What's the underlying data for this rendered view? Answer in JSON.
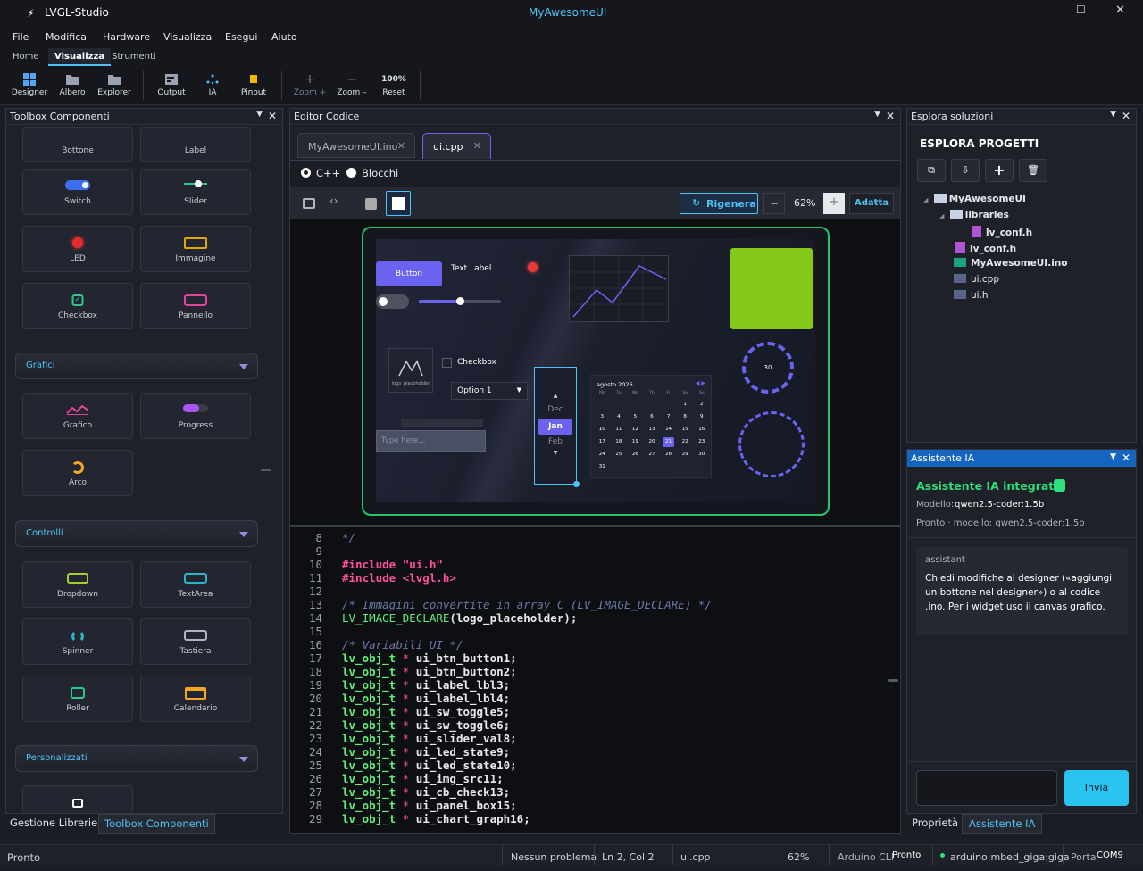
{
  "app": {
    "name": "LVGL-Studio",
    "window_title": "MyAwesomeUI"
  },
  "menu": [
    "File",
    "Modifica",
    "Hardware",
    "Visualizza",
    "Esegui",
    "Aiuto"
  ],
  "tabs": [
    "Home",
    "Visualizza",
    "Strumenti"
  ],
  "ribbon": {
    "designer": "Designer",
    "albero": "Albero",
    "explorer": "Explorer",
    "output": "Output",
    "ia": "IA",
    "pinout": "Pinout",
    "zoom_in": "Zoom +",
    "zoom_out": "Zoom –",
    "reset_value": "100%",
    "reset": "Reset"
  },
  "toolbox": {
    "title": "Toolbox Componenti",
    "items_top": [
      "Bottone",
      "Label",
      "Switch",
      "Slider",
      "LED",
      "Immagine",
      "Checkbox",
      "Pannello"
    ],
    "cat_graphs": "Grafici",
    "items_graphs": [
      "Grafico",
      "Progress",
      "Arco"
    ],
    "cat_controls": "Controlli",
    "items_controls": [
      "Dropdown",
      "TextArea",
      "Spinner",
      "Tastiera",
      "Roller",
      "Calendario"
    ],
    "cat_custom": "Personalizzati",
    "bottom_tabs": [
      "Gestione Librerie",
      "Toolbox Componenti"
    ]
  },
  "editor": {
    "title": "Editor Codice",
    "tabs": [
      "MyAwesomeUI.ino",
      "ui.cpp"
    ],
    "mode_cpp": "C++",
    "mode_blocks": "Blocchi",
    "regen": "Rigenera",
    "zoom": "62%",
    "fit": "Adatta",
    "preview": {
      "button": "Button",
      "text_label": "Text Label",
      "checkbox": "Checkbox",
      "dropdown": "Option 1",
      "placeholder": "Type here...",
      "logo": "logo_placeholder",
      "roller": [
        "Dec",
        "Jan",
        "Feb"
      ],
      "arc_value": "30",
      "calendar_title": "agosto 2026",
      "calendar_days": [
        "Mo",
        "Tu",
        "We",
        "Th",
        "Fr",
        "Sa",
        "Su"
      ],
      "calendar_rows": [
        [
          "",
          "",
          "",
          "",
          "",
          "1",
          "2"
        ],
        [
          "3",
          "4",
          "5",
          "6",
          "7",
          "8",
          "9"
        ],
        [
          "10",
          "11",
          "12",
          "13",
          "14",
          "15",
          "16"
        ],
        [
          "17",
          "18",
          "19",
          "20",
          "21",
          "22",
          "23"
        ],
        [
          "24",
          "25",
          "26",
          "27",
          "28",
          "29",
          "30"
        ],
        [
          "31",
          "",
          "",
          "",
          "",
          "",
          ""
        ]
      ],
      "calendar_selected": "21"
    },
    "line_numbers": [
      "8",
      "9",
      "10",
      "11",
      "12",
      "13",
      "14",
      "15",
      "16",
      "17",
      "18",
      "19",
      "20",
      "21",
      "22",
      "23",
      "24",
      "25",
      "26",
      "27",
      "28",
      "29"
    ],
    "code_lines": [
      {
        "t": "*/",
        "c": "comment"
      },
      {
        "t": "",
        "c": "plain"
      },
      {
        "t": "#include \"ui.h\"",
        "c": "pre"
      },
      {
        "t": "#include <lvgl.h>",
        "c": "pre"
      },
      {
        "t": "",
        "c": "plain"
      },
      {
        "t": "/* Immagini convertite in array C (LV_IMAGE_DECLARE) */",
        "c": "comment"
      },
      {
        "t": "LV_IMAGE_DECLARE(logo_placeholder);",
        "c": "macro"
      },
      {
        "t": "",
        "c": "plain"
      },
      {
        "t": "/* Variabili UI */",
        "c": "comment"
      },
      {
        "t": "lv_obj_t * ui_btn_button1;",
        "c": "decl"
      },
      {
        "t": "lv_obj_t * ui_btn_button2;",
        "c": "decl"
      },
      {
        "t": "lv_obj_t * ui_label_lbl3;",
        "c": "decl"
      },
      {
        "t": "lv_obj_t * ui_label_lbl4;",
        "c": "decl"
      },
      {
        "t": "lv_obj_t * ui_sw_toggle5;",
        "c": "decl"
      },
      {
        "t": "lv_obj_t * ui_sw_toggle6;",
        "c": "decl"
      },
      {
        "t": "lv_obj_t * ui_slider_val8;",
        "c": "decl"
      },
      {
        "t": "lv_obj_t * ui_led_state9;",
        "c": "decl"
      },
      {
        "t": "lv_obj_t * ui_led_state10;",
        "c": "decl"
      },
      {
        "t": "lv_obj_t * ui_img_src11;",
        "c": "decl"
      },
      {
        "t": "lv_obj_t * ui_cb_check13;",
        "c": "decl"
      },
      {
        "t": "lv_obj_t * ui_panel_box15;",
        "c": "decl"
      },
      {
        "t": "lv_obj_t * ui_chart_graph16;",
        "c": "decl"
      }
    ]
  },
  "solutions": {
    "title": "Esplora soluzioni",
    "header": "ESPLORA PROGETTI",
    "tree": [
      "MyAwesomeUI",
      "libraries",
      "lv_conf.h",
      "lv_conf.h",
      "MyAwesomeUI.ino",
      "ui.cpp",
      "ui.h"
    ]
  },
  "assistant": {
    "title": "Assistente IA",
    "heading": "Assistente IA integrato",
    "model_label": "Modello:",
    "model": "qwen2.5-coder:1.5b",
    "status": "Pronto · modello: qwen2.5-coder:1.5b",
    "role": "assistant",
    "message": "Chiedi modifiche al designer («aggiungi un bottone nel designer») o al codice .ino. Per i widget uso il canvas grafico.",
    "send": "Invia",
    "bottom_tabs": [
      "Proprietà",
      "Assistente IA"
    ]
  },
  "status": {
    "ready": "Pronto",
    "problems": "Nessun problema",
    "position": "Ln 2, Col 2",
    "file": "ui.cpp",
    "zoom": "62%",
    "cli_label": "Arduino CLI",
    "cli_state": "Pronto",
    "board": "arduino:mbed_giga:giga",
    "port_label": "Porta",
    "port": "COM9"
  },
  "colors": {
    "accent": "#4fc3f7",
    "bg": "#1b1d24",
    "preview_border": "#27c46a",
    "green_panel": "#84c91a",
    "purple": "#6b63f0"
  }
}
